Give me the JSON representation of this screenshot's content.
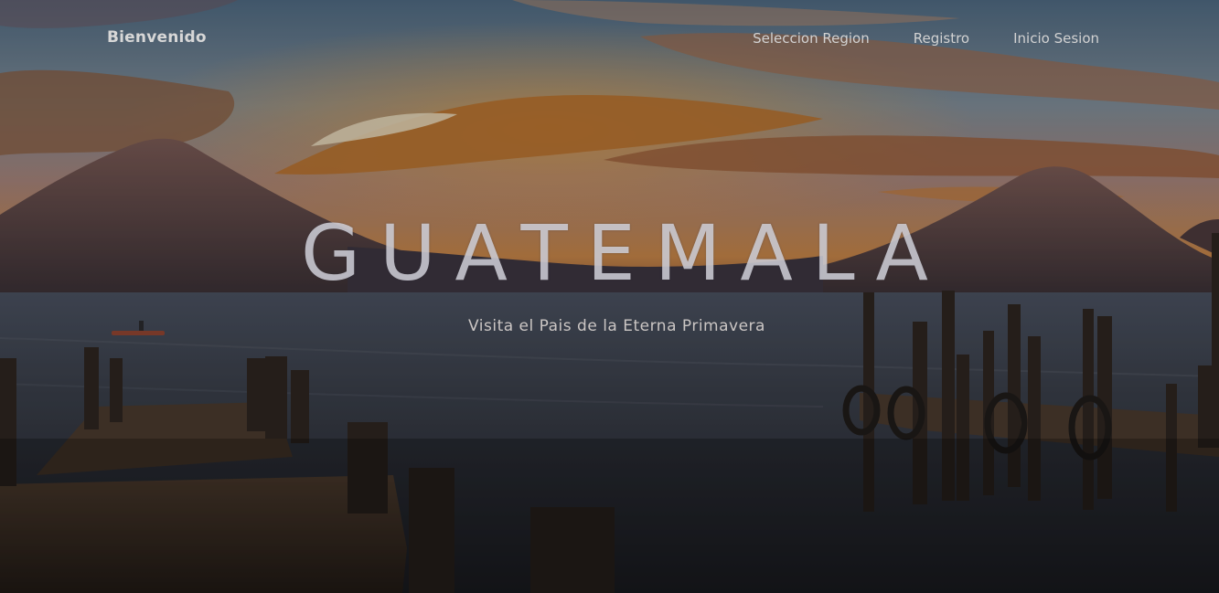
{
  "navbar": {
    "brand": "Bienvenido",
    "links": [
      {
        "label": "Seleccion Region"
      },
      {
        "label": "Registro"
      },
      {
        "label": "Inicio Sesion"
      }
    ]
  },
  "hero": {
    "title": "GUATEMALA",
    "subtitle": "Visita el Pais de la Eterna Primavera"
  },
  "colors": {
    "sky_top": "#5c7a93",
    "sunset_orange": "#d98a2c",
    "mountain": "#4a3a3c",
    "lake": "#343a45",
    "dock": "#3e3128"
  }
}
